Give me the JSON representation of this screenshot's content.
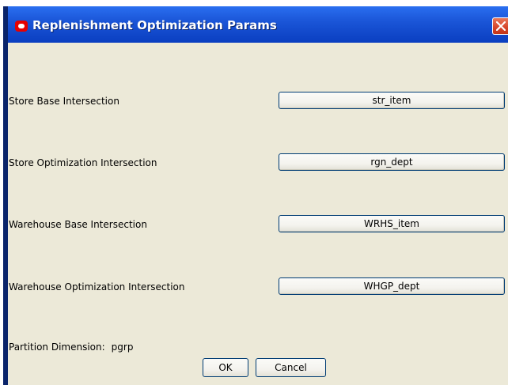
{
  "window": {
    "title": "Replenishment Optimization Params",
    "close_icon": "close-icon",
    "app_icon": "oracle-logo-icon",
    "title_bar_color": "#1b56d8"
  },
  "fields": [
    {
      "label": "Store Base Intersection",
      "value": "str_item"
    },
    {
      "label": "Store Optimization Intersection",
      "value": "rgn_dept"
    },
    {
      "label": "Warehouse Base Intersection",
      "value": "WRHS_item"
    },
    {
      "label": "Warehouse Optimization Intersection",
      "value": "WHGP_dept"
    }
  ],
  "partition": {
    "label": "Partition Dimension:",
    "value": "pgrp"
  },
  "buttons": {
    "ok": "OK",
    "cancel": "Cancel"
  }
}
